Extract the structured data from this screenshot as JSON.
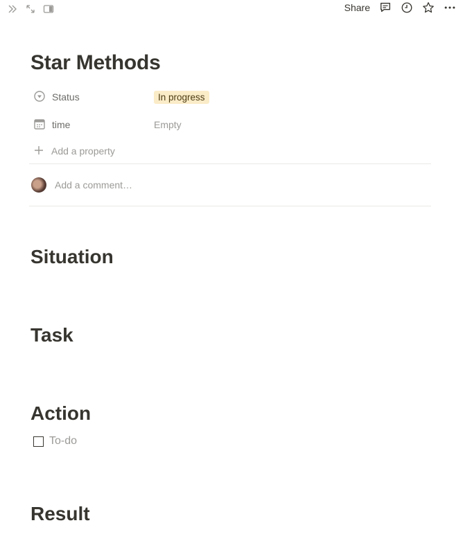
{
  "topbar": {
    "share_label": "Share",
    "icons": [
      "double-chevron-right-icon",
      "expand-arrows-icon",
      "side-peek-icon",
      "comment-icon",
      "clock-icon",
      "star-icon",
      "more-icon"
    ]
  },
  "page": {
    "title": "Star Methods",
    "properties": [
      {
        "icon": "status-icon",
        "name": "Status",
        "value": "In progress",
        "badge_color": "#fbecc8"
      },
      {
        "icon": "calendar-icon",
        "name": "time",
        "value": "Empty"
      }
    ],
    "add_property_label": "Add a property",
    "comment_placeholder": "Add a comment…",
    "sections": [
      "Situation",
      "Task",
      "Action",
      "Result"
    ],
    "todo_placeholder": "To-do"
  },
  "colors": {
    "text": "#37352f",
    "muted": "#9b9a97",
    "badge_bg": "#fbecc8",
    "divider": "#e9e9e7"
  }
}
